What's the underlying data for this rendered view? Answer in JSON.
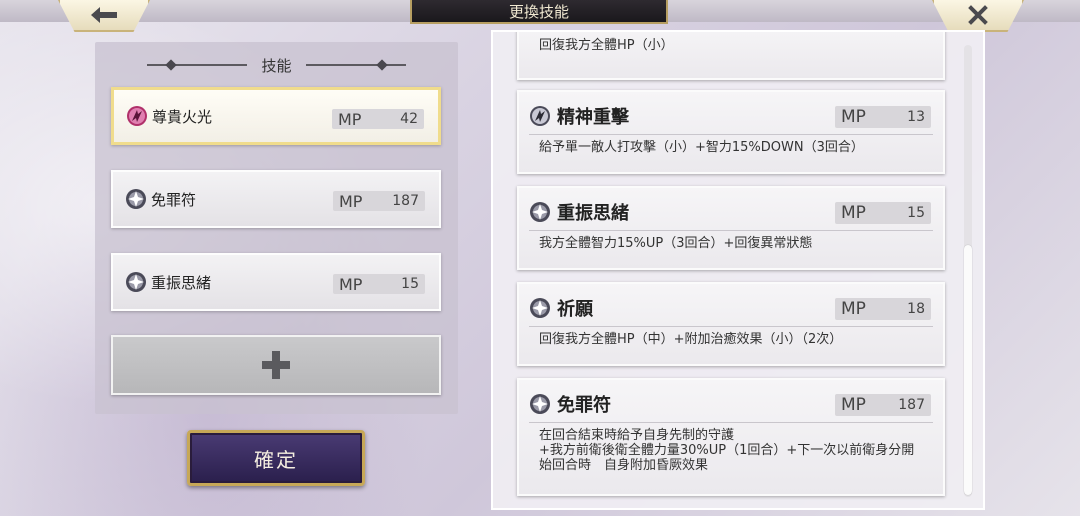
{
  "header": {
    "title": "更換技能",
    "back_icon": "back-arrow-icon",
    "close_icon": "close-icon"
  },
  "left_panel": {
    "title": "技能",
    "slots": [
      {
        "name": "尊貴火光",
        "mp_label": "MP",
        "mp_value": "42",
        "icon": "magic-skill-icon",
        "selected": true
      },
      {
        "name": "免罪符",
        "mp_label": "MP",
        "mp_value": "187",
        "icon": "support-skill-icon",
        "selected": false
      },
      {
        "name": "重振思緒",
        "mp_label": "MP",
        "mp_value": "15",
        "icon": "support-skill-icon",
        "selected": false
      }
    ],
    "add_icon": "plus-icon",
    "confirm_label": "確定"
  },
  "skill_list": {
    "partial_top_desc": "回復我方全體HP（小）",
    "cards": [
      {
        "name": "精神重擊",
        "mp_label": "MP",
        "mp_value": "13",
        "icon": "magic-skill-icon",
        "desc": "給予單一敵人打攻擊（小）+智力15%DOWN（3回合）"
      },
      {
        "name": "重振思緒",
        "mp_label": "MP",
        "mp_value": "15",
        "icon": "support-skill-icon",
        "desc": "我方全體智力15%UP（3回合）+回復異常狀態"
      },
      {
        "name": "祈願",
        "mp_label": "MP",
        "mp_value": "18",
        "icon": "support-skill-icon",
        "desc": "回復我方全體HP（中）+附加治癒效果（小）（2次）"
      },
      {
        "name": "免罪符",
        "mp_label": "MP",
        "mp_value": "187",
        "icon": "support-skill-icon",
        "desc": "在回合結束時給予自身先制的守護\n+我方前衛後衛全體力量30%UP（1回合）+下一次以前衛身分開始回合時　自身附加昏厥效果"
      }
    ]
  },
  "colors": {
    "magic_icon": "#b0306a",
    "support_icon": "#4a4a58",
    "selected_border": "#f0dc8c",
    "confirm_bg": "#3a2c62",
    "gold_trim": "#c7a857"
  }
}
